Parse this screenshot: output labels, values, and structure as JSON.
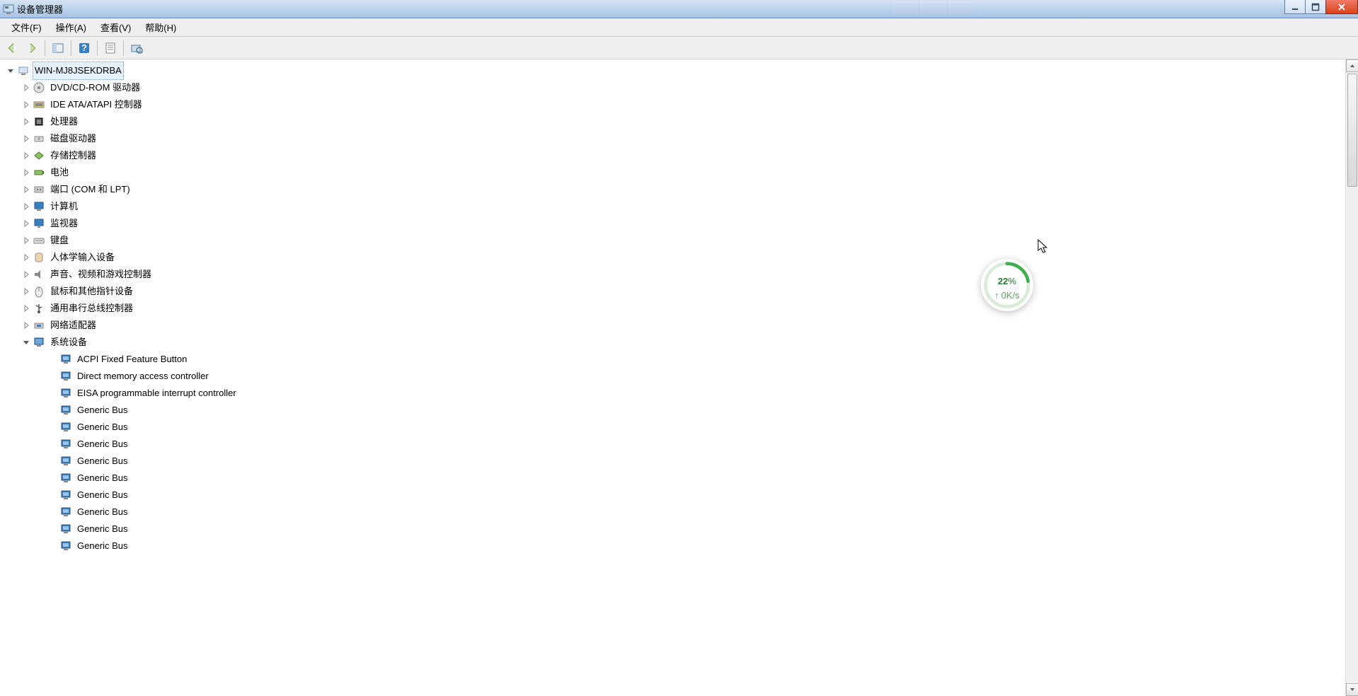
{
  "window": {
    "title": "设备管理器"
  },
  "menu": {
    "file": "文件(F)",
    "action": "操作(A)",
    "view": "查看(V)",
    "help": "帮助(H)"
  },
  "tree": {
    "root": "WIN-MJ8JSEKDRBA",
    "categories": [
      {
        "label": "DVD/CD-ROM 驱动器",
        "expanded": false,
        "icon": "disc"
      },
      {
        "label": "IDE ATA/ATAPI 控制器",
        "expanded": false,
        "icon": "ide"
      },
      {
        "label": "处理器",
        "expanded": false,
        "icon": "cpu"
      },
      {
        "label": "磁盘驱动器",
        "expanded": false,
        "icon": "disk"
      },
      {
        "label": "存储控制器",
        "expanded": false,
        "icon": "storage"
      },
      {
        "label": "电池",
        "expanded": false,
        "icon": "battery"
      },
      {
        "label": "端口 (COM 和 LPT)",
        "expanded": false,
        "icon": "port"
      },
      {
        "label": "计算机",
        "expanded": false,
        "icon": "computer"
      },
      {
        "label": "监视器",
        "expanded": false,
        "icon": "monitor"
      },
      {
        "label": "键盘",
        "expanded": false,
        "icon": "keyboard"
      },
      {
        "label": "人体学输入设备",
        "expanded": false,
        "icon": "hid"
      },
      {
        "label": "声音、视频和游戏控制器",
        "expanded": false,
        "icon": "sound"
      },
      {
        "label": "鼠标和其他指针设备",
        "expanded": false,
        "icon": "mouse"
      },
      {
        "label": "通用串行总线控制器",
        "expanded": false,
        "icon": "usb"
      },
      {
        "label": "网络适配器",
        "expanded": false,
        "icon": "network"
      },
      {
        "label": "系统设备",
        "expanded": true,
        "icon": "system",
        "children": [
          "ACPI Fixed Feature Button",
          "Direct memory access controller",
          "EISA programmable interrupt controller",
          "Generic Bus",
          "Generic Bus",
          "Generic Bus",
          "Generic Bus",
          "Generic Bus",
          "Generic Bus",
          "Generic Bus",
          "Generic Bus",
          "Generic Bus"
        ]
      }
    ]
  },
  "overlay": {
    "percent": "22",
    "percent_unit": "%",
    "sub_arrow": "↑",
    "sub_speed": "0K/s"
  }
}
